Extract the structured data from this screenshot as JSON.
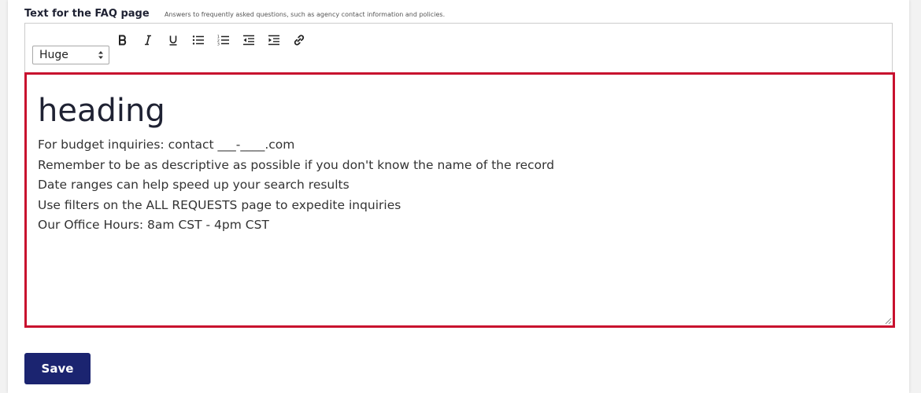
{
  "field": {
    "label": "Text for the FAQ page",
    "hint": "Answers to frequently asked questions, such as agency contact information and policies."
  },
  "toolbar": {
    "size_value": "Huge",
    "buttons": [
      "bold-icon",
      "italic-icon",
      "underline-icon",
      "bulleted-list-icon",
      "numbered-list-icon",
      "outdent-icon",
      "indent-icon",
      "link-icon"
    ]
  },
  "editor": {
    "heading": "heading",
    "lines": [
      "For budget inquiries: contact ___-____.com",
      "Remember to be as descriptive as possible if you don't know the name of the record",
      "Date ranges can help speed up your search results",
      "Use filters on the ALL REQUESTS page to expedite inquiries",
      "Our Office Hours: 8am CST - 4pm CST"
    ]
  },
  "actions": {
    "save_label": "Save"
  },
  "colors": {
    "focus_border": "#c8102e",
    "primary_button": "#1b2470",
    "heading_text": "#1f2233"
  }
}
